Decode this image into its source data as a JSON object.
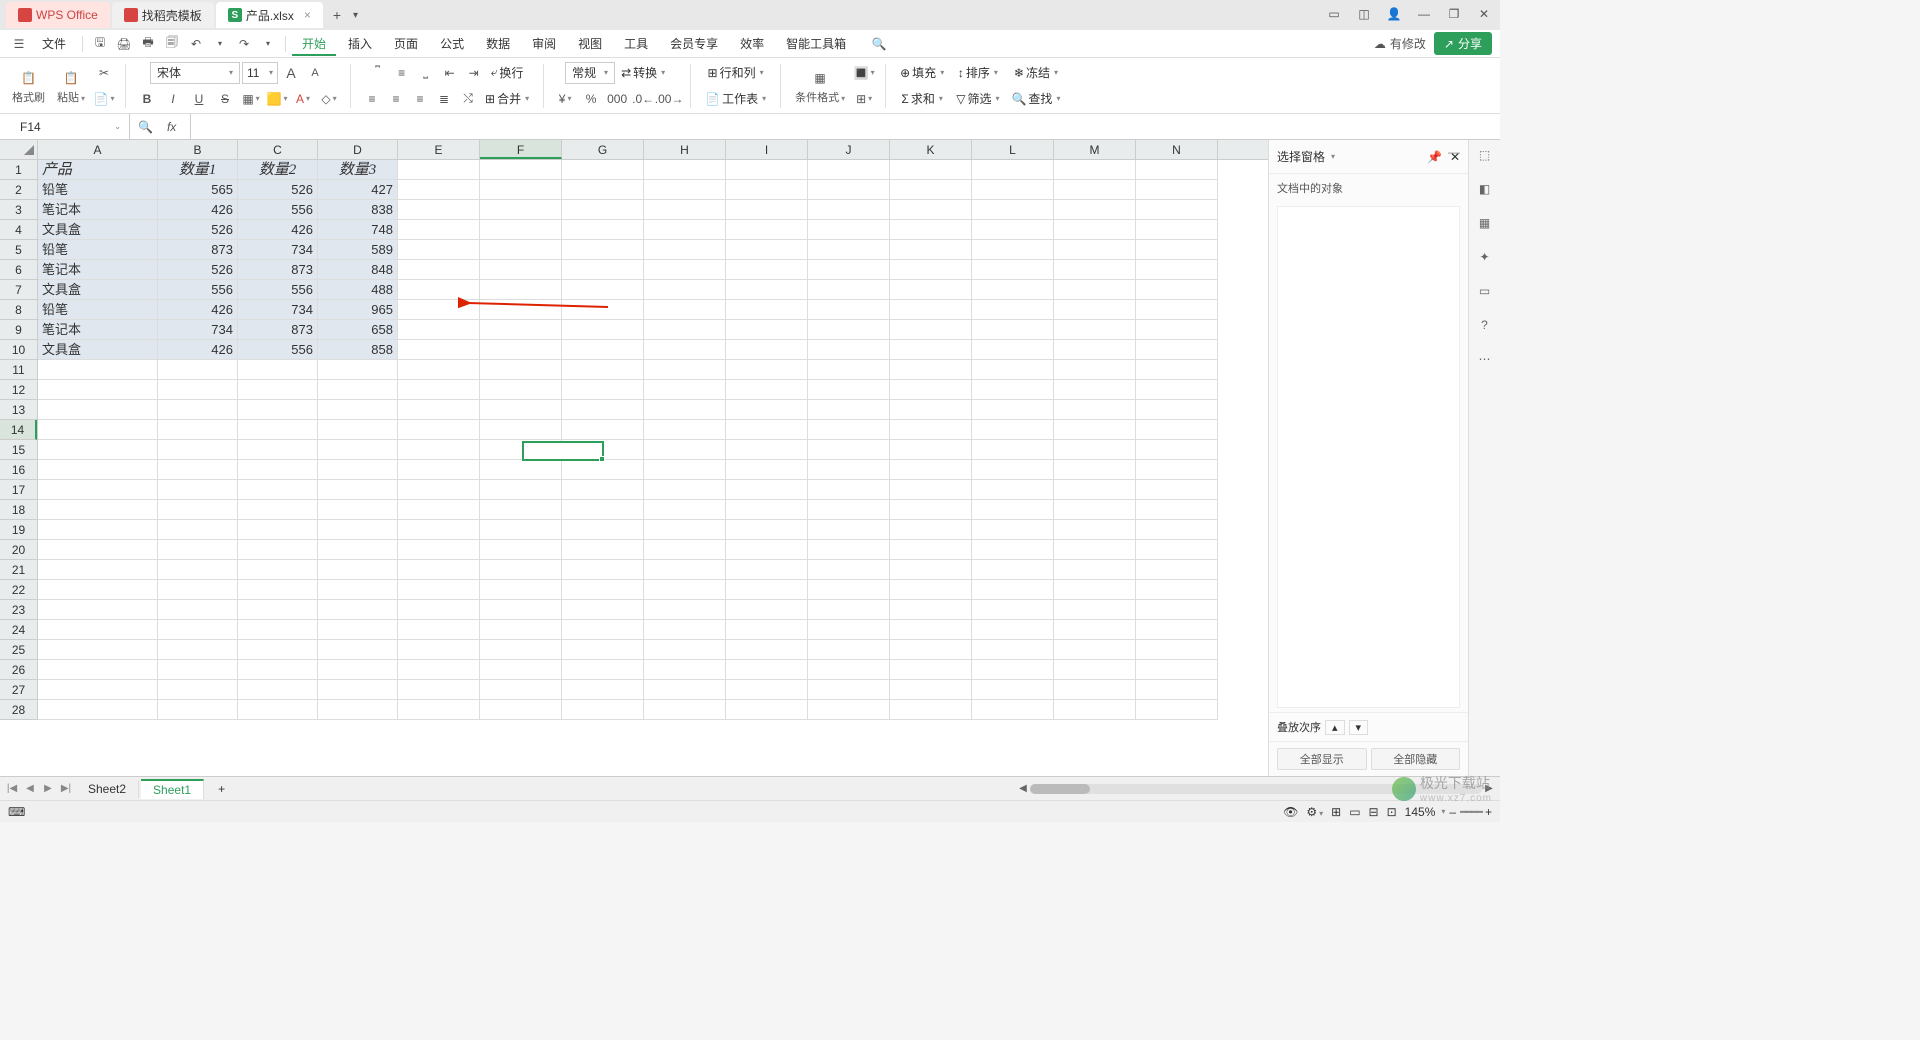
{
  "tabs": {
    "wps": "WPS Office",
    "template": "找稻壳模板",
    "file": "产品.xlsx",
    "file_close": "×",
    "plus": "+",
    "caret": "▾"
  },
  "window_controls": {
    "box": "▭",
    "cube": "◫",
    "avatar": "👤",
    "min": "—",
    "max": "❐",
    "close": "✕"
  },
  "file_menu": {
    "hamburger": "☰",
    "label": "文件"
  },
  "quickbar": {
    "save": "🖫",
    "pdf": "🖨",
    "print": "🖶",
    "preview": "🗐",
    "undo": "↶",
    "caret": "▾",
    "redo": "↷"
  },
  "menus": [
    "开始",
    "插入",
    "页面",
    "公式",
    "数据",
    "审阅",
    "视图",
    "工具",
    "会员专享",
    "效率",
    "智能工具箱"
  ],
  "menu_right": {
    "search": "🔍",
    "cloud": "☁",
    "changes": "有修改",
    "share_icon": "↗",
    "share": "分享"
  },
  "ribbon": {
    "paste_icon": "📋",
    "format_brush": "格式刷",
    "paste": "粘贴",
    "scissors": "✂",
    "font": "宋体",
    "size": "11",
    "A_big": "A",
    "A_small": "A",
    "caret": "▾",
    "bold": "B",
    "italic": "I",
    "underline": "U",
    "strike": "S",
    "align_label": "合并",
    "wrap": "换行",
    "number_format": "常规",
    "convert": "转换",
    "row_col": "行和列",
    "worksheet": "工作表",
    "cond_format": "条件格式",
    "fill": "填充",
    "sort": "排序",
    "freeze": "冻结",
    "sum": "求和",
    "filter": "筛选",
    "find": "查找"
  },
  "formula_bar": {
    "cell_ref": "F14",
    "expand": "⌄",
    "fx": "fx",
    "zoom": "🔍",
    "content": ""
  },
  "columns": [
    "A",
    "B",
    "C",
    "D",
    "E",
    "F",
    "G",
    "H",
    "I",
    "J",
    "K",
    "L",
    "M",
    "N"
  ],
  "row_count": 28,
  "selected_col": "F",
  "selected_row": 14,
  "data": {
    "headers": [
      "产品",
      "数量1",
      "数量2",
      "数量3"
    ],
    "rows": [
      [
        "铅笔",
        "565",
        "526",
        "427"
      ],
      [
        "笔记本",
        "426",
        "556",
        "838"
      ],
      [
        "文具盒",
        "526",
        "426",
        "748"
      ],
      [
        "铅笔",
        "873",
        "734",
        "589"
      ],
      [
        "笔记本",
        "526",
        "873",
        "848"
      ],
      [
        "文具盒",
        "556",
        "556",
        "488"
      ],
      [
        "铅笔",
        "426",
        "734",
        "965"
      ],
      [
        "笔记本",
        "734",
        "873",
        "658"
      ],
      [
        "文具盒",
        "426",
        "556",
        "858"
      ]
    ]
  },
  "right_panel": {
    "title": "选择窗格",
    "caret": "▾",
    "pin": "📌",
    "close": "✕",
    "minimize": "—",
    "body_label": "文档中的对象",
    "stack": "叠放次序",
    "up": "▴",
    "down": "▾",
    "show_all": "全部显示",
    "hide_all": "全部隐藏"
  },
  "side_tools": [
    "⬚",
    "◧",
    "▦",
    "✦",
    "▭",
    "?",
    "⋯"
  ],
  "sheets": {
    "nav": [
      "|◀",
      "◀",
      "▶",
      "▶|"
    ],
    "list": [
      "Sheet2",
      "Sheet1"
    ],
    "active": "Sheet1",
    "add": "+"
  },
  "status": {
    "keyboard": "⌨",
    "eye": "👁",
    "settings": "⚙",
    "grid": "⊞",
    "layout1": "▭",
    "layout2": "⊟",
    "layout3": "⊡",
    "zoom": "145%",
    "caret": "▾",
    "minus": "–",
    "slider": "━━━━",
    "plus": "+",
    "hscroll_left": "◀",
    "hscroll_right": "▶"
  },
  "watermark": {
    "brand": "极光下载站",
    "url": "www.xz7.com"
  }
}
